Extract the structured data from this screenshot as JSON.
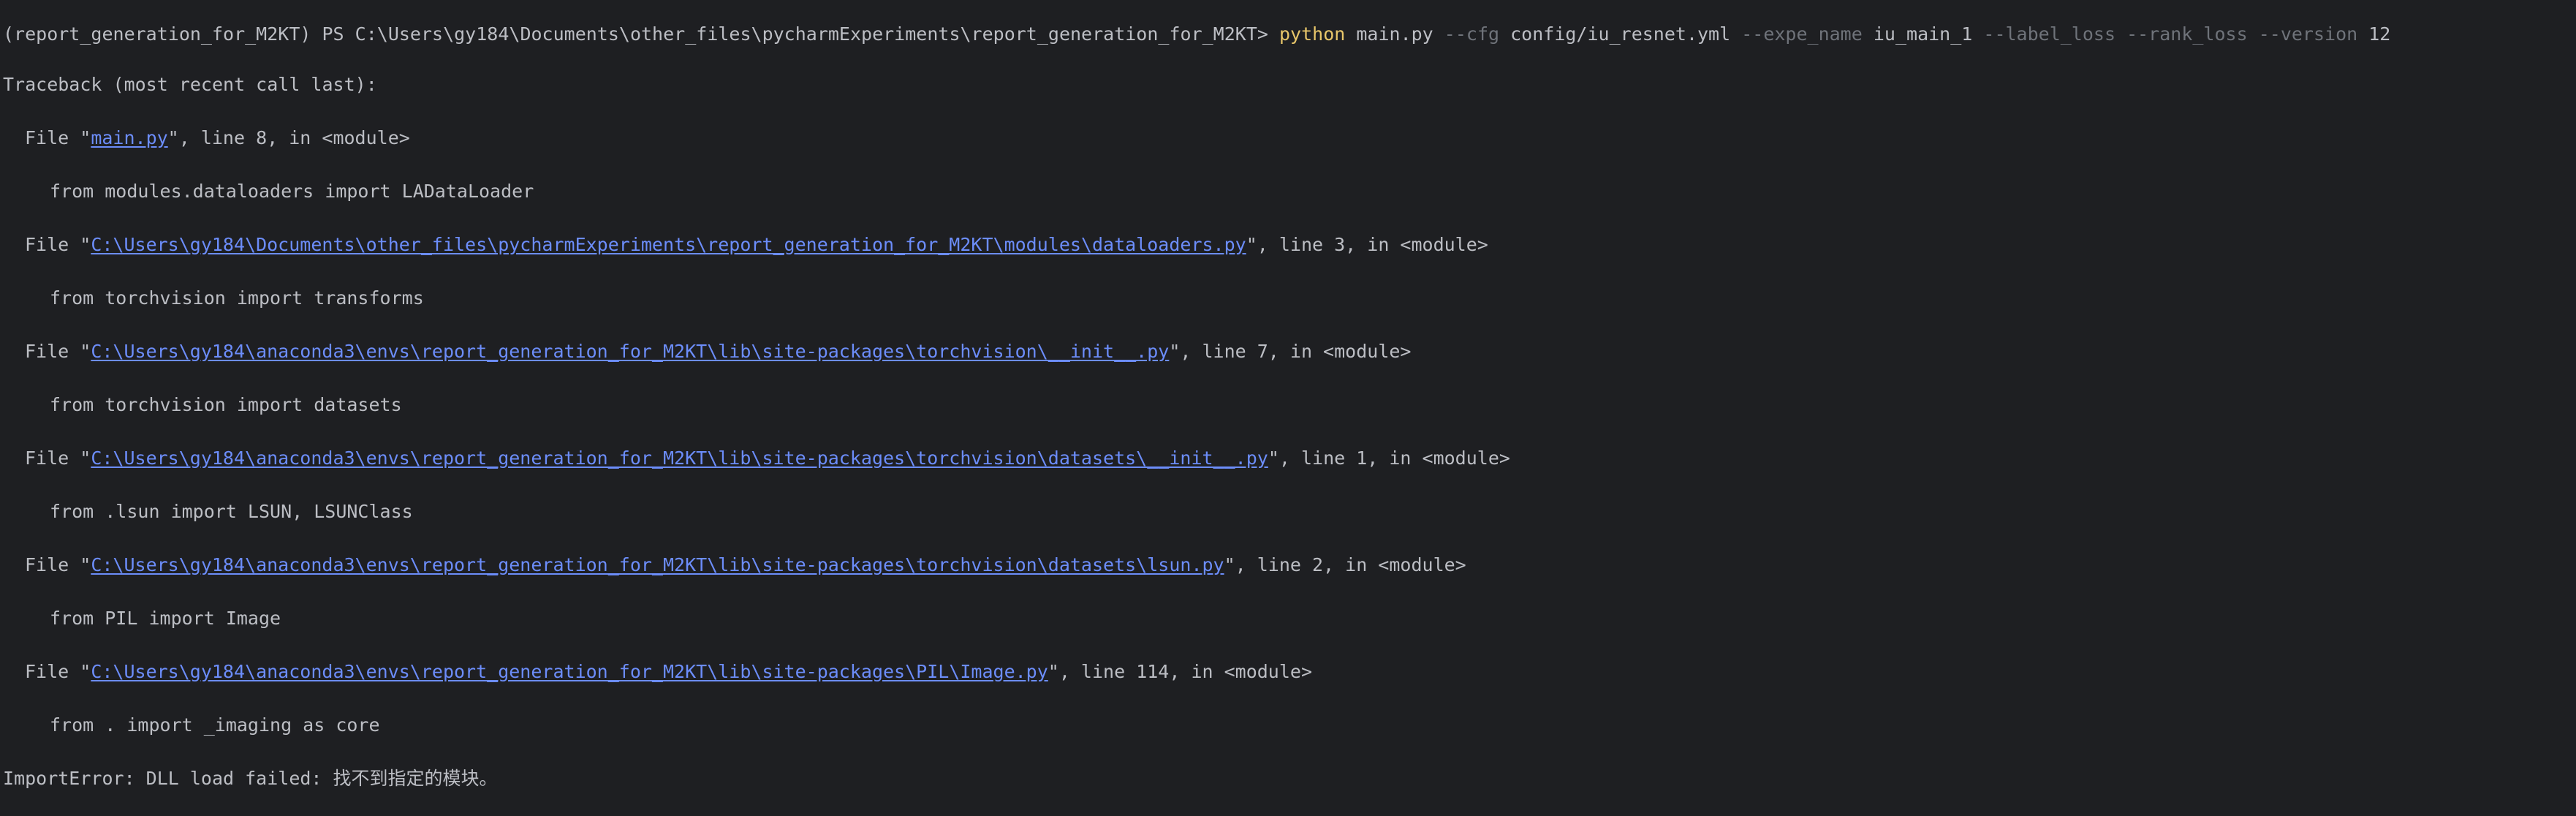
{
  "prompt": {
    "env": "(report_generation_for_M2KT)",
    "ps": "PS",
    "cwd": "C:\\Users\\gy184\\Documents\\other_files\\pycharmExperiments\\report_generation_for_M2KT>"
  },
  "command": {
    "name": "python",
    "script": "main.py",
    "cfg_flag": "--cfg",
    "cfg_value": "config/iu_resnet.yml",
    "expe_flag": "--expe_name",
    "expe_value": "iu_main_1",
    "label_loss_flag": "--label_loss",
    "rank_loss_flag": "--rank_loss",
    "version_flag": "--version",
    "version_value": "12"
  },
  "traceback_header": "Traceback (most recent call last):",
  "frames": [
    {
      "file_prefix": "File \"",
      "path": "main.py",
      "suffix": "\", line 8, in <module>",
      "code": "from modules.dataloaders import LADataLoader"
    },
    {
      "file_prefix": "File \"",
      "path": "C:\\Users\\gy184\\Documents\\other_files\\pycharmExperiments\\report_generation_for_M2KT\\modules\\dataloaders.py",
      "suffix": "\", line 3, in <module>",
      "code": "from torchvision import transforms"
    },
    {
      "file_prefix": "File \"",
      "path": "C:\\Users\\gy184\\anaconda3\\envs\\report_generation_for_M2KT\\lib\\site-packages\\torchvision\\__init__.py",
      "suffix": "\", line 7, in <module>",
      "code": "from torchvision import datasets"
    },
    {
      "file_prefix": "File \"",
      "path": "C:\\Users\\gy184\\anaconda3\\envs\\report_generation_for_M2KT\\lib\\site-packages\\torchvision\\datasets\\__init__.py",
      "suffix": "\", line 1, in <module>",
      "code": "from .lsun import LSUN, LSUNClass"
    },
    {
      "file_prefix": "File \"",
      "path": "C:\\Users\\gy184\\anaconda3\\envs\\report_generation_for_M2KT\\lib\\site-packages\\torchvision\\datasets\\lsun.py",
      "suffix": "\", line 2, in <module>",
      "code": "from PIL import Image"
    },
    {
      "file_prefix": "File \"",
      "path": "C:\\Users\\gy184\\anaconda3\\envs\\report_generation_for_M2KT\\lib\\site-packages\\PIL\\Image.py",
      "suffix": "\", line 114, in <module>",
      "code": "from . import _imaging as core"
    }
  ],
  "error": "ImportError: DLL load failed: 找不到指定的模块。",
  "colors": {
    "background": "#1e1f22",
    "text": "#bcbec4",
    "command": "#e8c66a",
    "flag": "#6f737a",
    "link": "#6c8dfa"
  }
}
